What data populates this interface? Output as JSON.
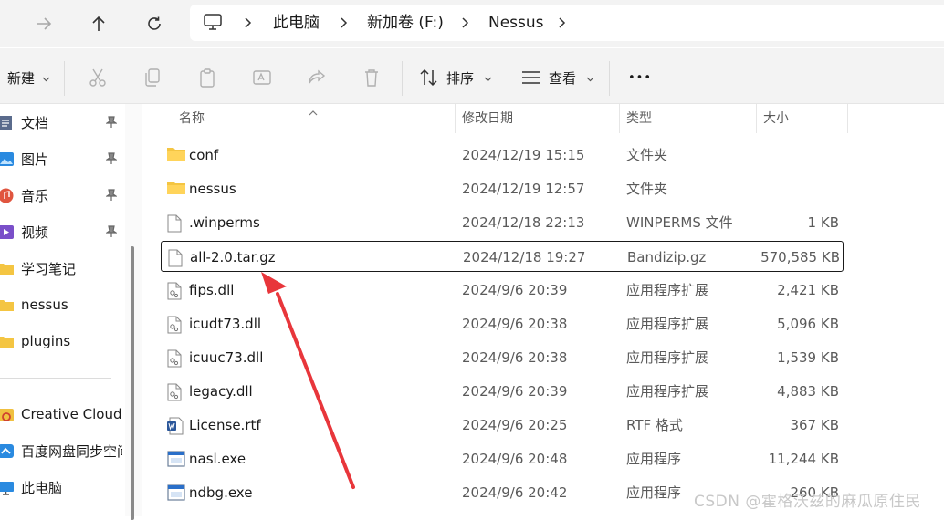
{
  "breadcrumb": [
    "此电脑",
    "新加卷 (F:)",
    "Nessus"
  ],
  "toolbar": {
    "new_label": "新建",
    "sort_label": "排序",
    "view_label": "查看",
    "more_label": "•••"
  },
  "sidebar": {
    "items": [
      {
        "label": "文档",
        "icon": "document-icon",
        "pinned": true
      },
      {
        "label": "图片",
        "icon": "pictures-icon",
        "pinned": true
      },
      {
        "label": "音乐",
        "icon": "music-icon",
        "pinned": true
      },
      {
        "label": "视频",
        "icon": "video-icon",
        "pinned": true
      },
      {
        "label": "学习笔记",
        "icon": "folder-icon",
        "pinned": false
      },
      {
        "label": "nessus",
        "icon": "folder-icon",
        "pinned": false
      },
      {
        "label": "plugins",
        "icon": "folder-icon",
        "pinned": false
      },
      {
        "label": "Creative Cloud",
        "icon": "creative-cloud-icon",
        "pinned": false
      },
      {
        "label": "百度网盘同步空间",
        "icon": "baidu-netdisk-icon",
        "pinned": false
      },
      {
        "label": "此电脑",
        "icon": "computer-icon",
        "pinned": false
      }
    ]
  },
  "columns": {
    "name": "名称",
    "modified": "修改日期",
    "type": "类型",
    "size": "大小"
  },
  "files": [
    {
      "name": "conf",
      "modified": "2024/12/19 15:15",
      "type": "文件夹",
      "size": "",
      "icon": "folder-icon"
    },
    {
      "name": "nessus",
      "modified": "2024/12/19 12:57",
      "type": "文件夹",
      "size": "",
      "icon": "folder-icon"
    },
    {
      "name": ".winperms",
      "modified": "2024/12/18 22:13",
      "type": "WINPERMS 文件",
      "size": "1 KB",
      "icon": "file-icon"
    },
    {
      "name": "all-2.0.tar.gz",
      "modified": "2024/12/18 19:27",
      "type": "Bandizip.gz",
      "size": "570,585 KB",
      "icon": "file-icon",
      "selected": true
    },
    {
      "name": "fips.dll",
      "modified": "2024/9/6 20:39",
      "type": "应用程序扩展",
      "size": "2,421 KB",
      "icon": "dll-icon"
    },
    {
      "name": "icudt73.dll",
      "modified": "2024/9/6 20:38",
      "type": "应用程序扩展",
      "size": "5,096 KB",
      "icon": "dll-icon"
    },
    {
      "name": "icuuc73.dll",
      "modified": "2024/9/6 20:38",
      "type": "应用程序扩展",
      "size": "1,539 KB",
      "icon": "dll-icon"
    },
    {
      "name": "legacy.dll",
      "modified": "2024/9/6 20:39",
      "type": "应用程序扩展",
      "size": "4,883 KB",
      "icon": "dll-icon"
    },
    {
      "name": "License.rtf",
      "modified": "2024/9/6 20:25",
      "type": "RTF 格式",
      "size": "367 KB",
      "icon": "word-doc-icon"
    },
    {
      "name": "nasl.exe",
      "modified": "2024/9/6 20:48",
      "type": "应用程序",
      "size": "11,244 KB",
      "icon": "exe-icon"
    },
    {
      "name": "ndbg.exe",
      "modified": "2024/9/6 20:42",
      "type": "应用程序",
      "size": "260 KB",
      "icon": "exe-icon"
    }
  ],
  "watermark": "CSDN @霍格沃兹的麻瓜原住民",
  "colors": {
    "arrow": "#e8363b",
    "folder": "#f4c542",
    "accent": "#0067c0"
  }
}
